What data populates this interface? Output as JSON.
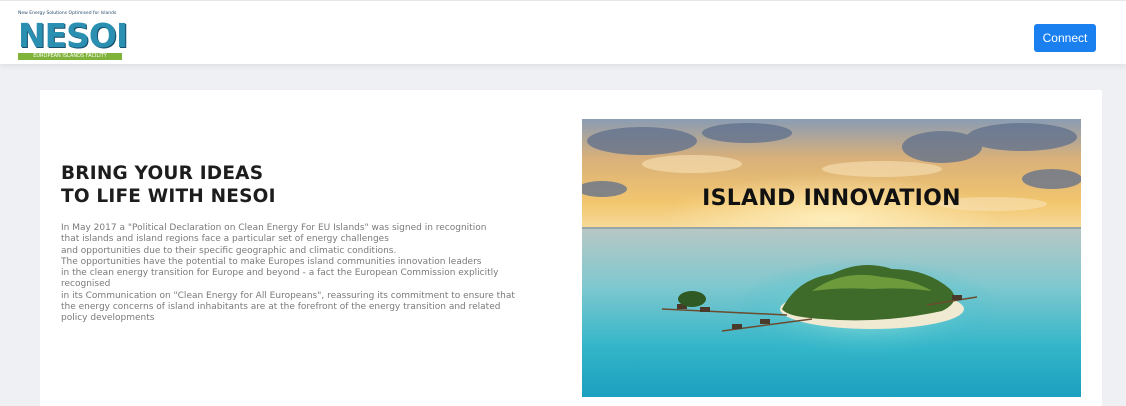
{
  "header": {
    "logo": {
      "tagline": "New Energy Solutions Optimised for Islands",
      "wordmark": "NESOI",
      "subtitle": "EUROPEAN ISLANDS FACILITY"
    },
    "connect_label": "Connect"
  },
  "main": {
    "headline": [
      "BRING YOUR IDEAS",
      "TO LIFE WITH NESOI"
    ],
    "paragraph_lines": [
      "In May 2017 a \"Political Declaration on Clean Energy For EU Islands\" was signed in recognition",
      "that islands and island regions face a particular set of energy challenges",
      "and opportunities due to their specific geographic and climatic conditions.",
      "The opportunities have the potential to make Europes island communities innovation leaders",
      "in the clean energy transition for Europe and beyond - a fact the European Commission explicitly",
      "recognised",
      "in its Communication on \"Clean Energy for All Europeans\", reassuring its commitment to ensure that",
      "the energy concerns of island inhabitants are at the forefront of the energy transition and related",
      "policy developments"
    ],
    "hero": {
      "title": "ISLAND INNOVATION"
    }
  },
  "colors": {
    "accent": "#1a80f0",
    "page_bg": "#eef0f4",
    "logo_blue": "#2a8fb0",
    "logo_green": "#7fb33a"
  }
}
